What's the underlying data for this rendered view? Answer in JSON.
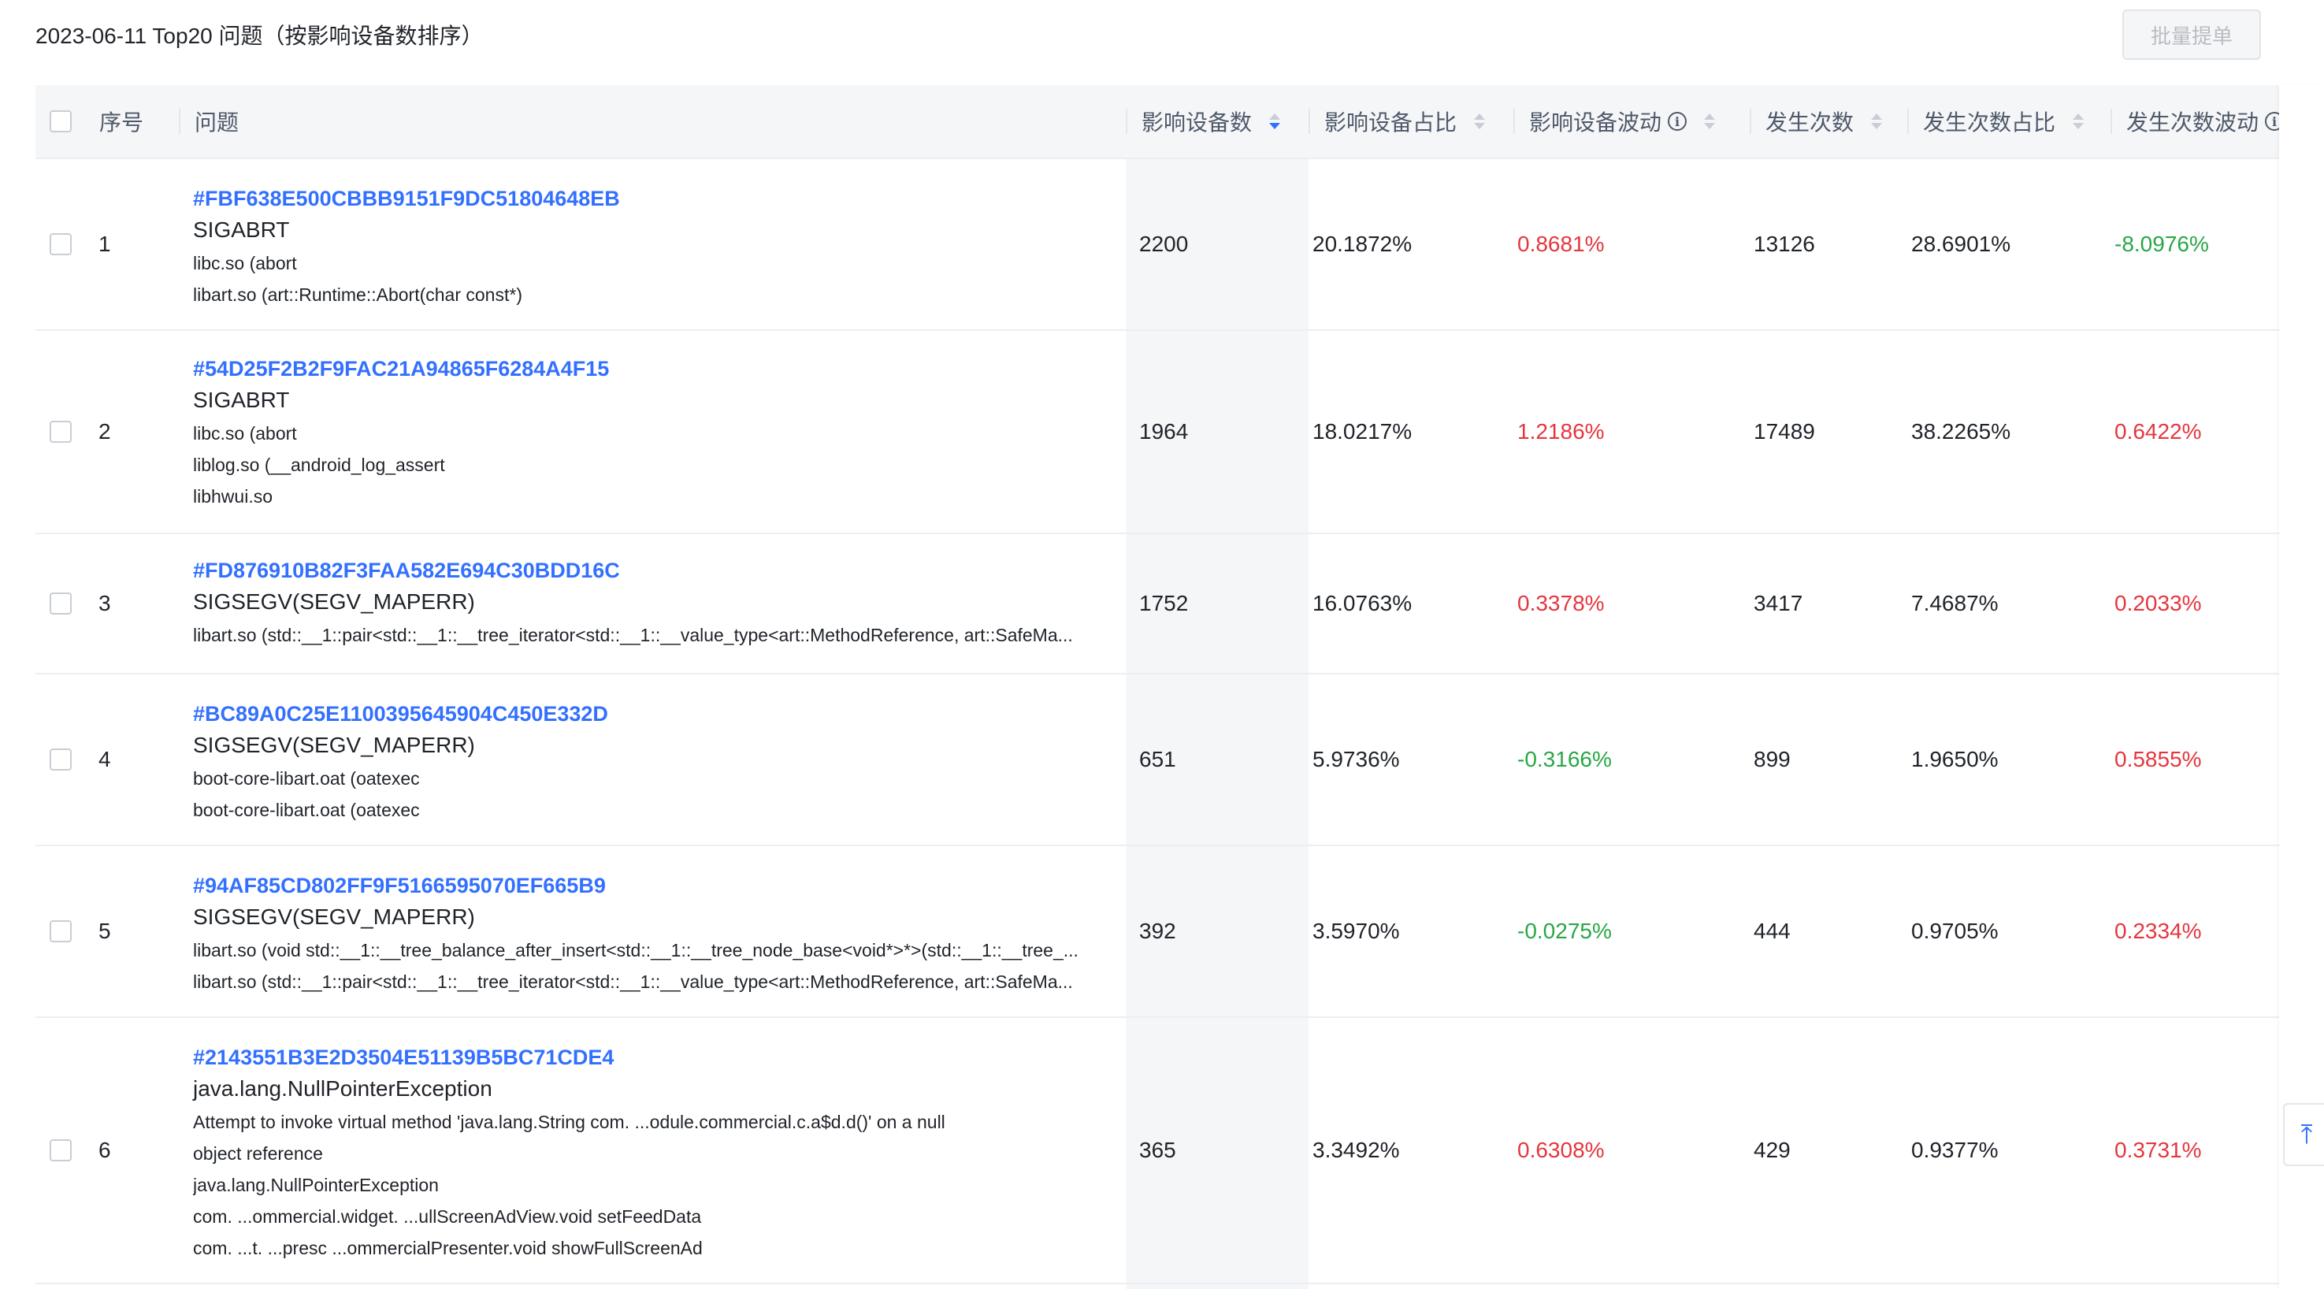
{
  "page": {
    "title": "2023-06-11 Top20 问题（按影响设备数排序）",
    "batch_button": "批量提单"
  },
  "columns": {
    "index": "序号",
    "issue": "问题",
    "device_count": "影响设备数",
    "device_ratio": "影响设备占比",
    "device_change": "影响设备波动",
    "occurrences": "发生次数",
    "occ_ratio": "发生次数占比",
    "occ_change": "发生次数波动"
  },
  "sort": {
    "column": "device_count",
    "direction": "desc"
  },
  "colors": {
    "link": "#3370ff",
    "up": "#e5363e",
    "down": "#28a745"
  },
  "rows": [
    {
      "index": "1",
      "id": "#FBF638E500CBBB9151F9DC51804648EB",
      "type": "SIGABRT",
      "lines": [
        "libc.so (abort",
        "libart.so (art::Runtime::Abort(char const*)"
      ],
      "device_count": "2200",
      "device_ratio": "20.1872%",
      "device_change": "0.8681%",
      "device_trend": "up",
      "occurrences": "13126",
      "occ_ratio": "28.6901%",
      "occ_change": "-8.0976%",
      "occ_trend": "down"
    },
    {
      "index": "2",
      "id": "#54D25F2B2F9FAC21A94865F6284A4F15",
      "type": "SIGABRT",
      "lines": [
        "libc.so (abort",
        "liblog.so (__android_log_assert",
        "libhwui.so"
      ],
      "device_count": "1964",
      "device_ratio": "18.0217%",
      "device_change": "1.2186%",
      "device_trend": "up",
      "occurrences": "17489",
      "occ_ratio": "38.2265%",
      "occ_change": "0.6422%",
      "occ_trend": "up"
    },
    {
      "index": "3",
      "id": "#FD876910B82F3FAA582E694C30BDD16C",
      "type": "SIGSEGV(SEGV_MAPERR)",
      "lines": [
        "libart.so (std::__1::pair<std::__1::__tree_iterator<std::__1::__value_type<art::MethodReference, art::SafeMa..."
      ],
      "device_count": "1752",
      "device_ratio": "16.0763%",
      "device_change": "0.3378%",
      "device_trend": "up",
      "occurrences": "3417",
      "occ_ratio": "7.4687%",
      "occ_change": "0.2033%",
      "occ_trend": "up"
    },
    {
      "index": "4",
      "id": "#BC89A0C25E1100395645904C450E332D",
      "type": "SIGSEGV(SEGV_MAPERR)",
      "lines": [
        "boot-core-libart.oat (oatexec",
        "boot-core-libart.oat (oatexec"
      ],
      "device_count": "651",
      "device_ratio": "5.9736%",
      "device_change": "-0.3166%",
      "device_trend": "down",
      "occurrences": "899",
      "occ_ratio": "1.9650%",
      "occ_change": "0.5855%",
      "occ_trend": "up"
    },
    {
      "index": "5",
      "id": "#94AF85CD802FF9F5166595070EF665B9",
      "type": "SIGSEGV(SEGV_MAPERR)",
      "lines": [
        "libart.so (void std::__1::__tree_balance_after_insert<std::__1::__tree_node_base<void*>*>(std::__1::__tree_...",
        "libart.so (std::__1::pair<std::__1::__tree_iterator<std::__1::__value_type<art::MethodReference, art::SafeMa..."
      ],
      "device_count": "392",
      "device_ratio": "3.5970%",
      "device_change": "-0.0275%",
      "device_trend": "down",
      "occurrences": "444",
      "occ_ratio": "0.9705%",
      "occ_change": "0.2334%",
      "occ_trend": "up"
    },
    {
      "index": "6",
      "id": "#2143551B3E2D3504E51139B5BC71CDE4",
      "type": "java.lang.NullPointerException",
      "lines": [
        "Attempt to invoke virtual method 'java.lang.String com.  ...odule.commercial.c.a$d.d()' on a null",
        "object reference",
        "java.lang.NullPointerException",
        "com.  ...ommercial.widget. ...ullScreenAdView.void setFeedData",
        "com.  ...t.  ...presc  ...ommercialPresenter.void showFullScreenAd"
      ],
      "device_count": "365",
      "device_ratio": "3.3492%",
      "device_change": "0.6308%",
      "device_trend": "up",
      "occurrences": "429",
      "occ_ratio": "0.9377%",
      "occ_change": "0.3731%",
      "occ_trend": "up"
    }
  ]
}
